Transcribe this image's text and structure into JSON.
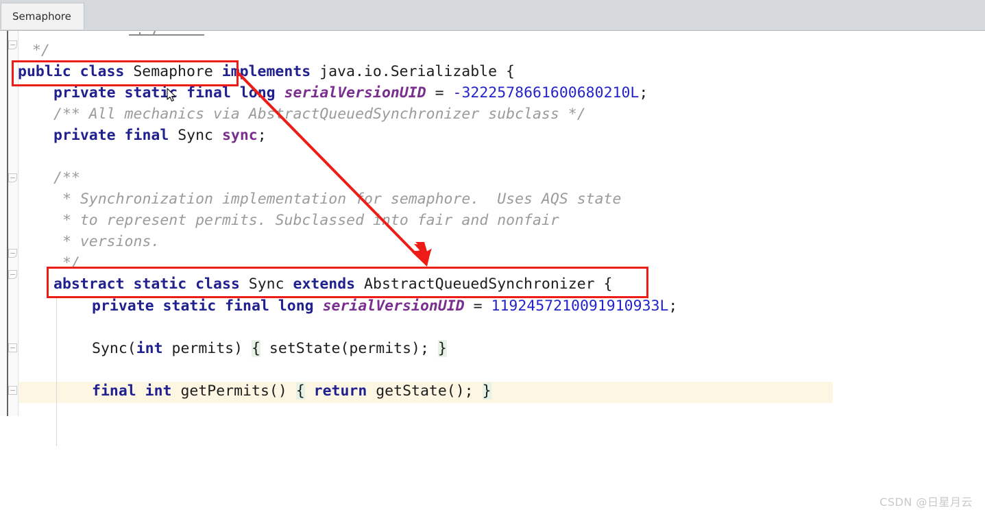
{
  "window": {
    "tab_label": "Semaphore"
  },
  "editor": {
    "language": "java",
    "lines": [
      {
        "n": 1,
        "indent": 0,
        "text": " */"
      },
      {
        "n": 2,
        "indent": 0,
        "text": "public class Semaphore implements java.io.Serializable {"
      },
      {
        "n": 3,
        "indent": 1,
        "text": "private static final long serialVersionUID = -3222578661600680210L;"
      },
      {
        "n": 4,
        "indent": 1,
        "text": "/** All mechanics via AbstractQueuedSynchronizer subclass */"
      },
      {
        "n": 5,
        "indent": 1,
        "text": "private final Sync sync;"
      },
      {
        "n": 6,
        "indent": 0,
        "text": ""
      },
      {
        "n": 7,
        "indent": 1,
        "text": "/**"
      },
      {
        "n": 8,
        "indent": 1,
        "text": " * Synchronization implementation for semaphore.  Uses AQS state"
      },
      {
        "n": 9,
        "indent": 1,
        "text": " * to represent permits. Subclassed into fair and nonfair"
      },
      {
        "n": 10,
        "indent": 1,
        "text": " * versions."
      },
      {
        "n": 11,
        "indent": 1,
        "text": " */"
      },
      {
        "n": 12,
        "indent": 1,
        "text": "abstract static class Sync extends AbstractQueuedSynchronizer {"
      },
      {
        "n": 13,
        "indent": 2,
        "text": "private static final long serialVersionUID = 1192457210091910933L;"
      },
      {
        "n": 14,
        "indent": 0,
        "text": ""
      },
      {
        "n": 15,
        "indent": 2,
        "text": "Sync(int permits) { setState(permits); }"
      },
      {
        "n": 16,
        "indent": 0,
        "text": ""
      },
      {
        "n": 17,
        "indent": 2,
        "text": "final int getPermits() { return getState(); }"
      }
    ],
    "tokens": {
      "line2": [
        {
          "t": "public",
          "c": "kw"
        },
        {
          "t": " ",
          "c": "plain"
        },
        {
          "t": "class",
          "c": "kw"
        },
        {
          "t": " ",
          "c": "plain"
        },
        {
          "t": "Semaphore",
          "c": "ident"
        },
        {
          "t": " ",
          "c": "plain"
        },
        {
          "t": "implements",
          "c": "kw"
        },
        {
          "t": " java.io.Serializable {",
          "c": "plain"
        }
      ],
      "line3": [
        {
          "t": "private static final long",
          "c": "kw"
        },
        {
          "t": " ",
          "c": "plain"
        },
        {
          "t": "serialVersionUID",
          "c": "field"
        },
        {
          "t": " = ",
          "c": "plain"
        },
        {
          "t": "-3222578661600680210L",
          "c": "num"
        },
        {
          "t": ";",
          "c": "plain"
        }
      ],
      "line5": [
        {
          "t": "private final",
          "c": "kw"
        },
        {
          "t": " Sync ",
          "c": "plain"
        },
        {
          "t": "sync",
          "c": "fieldu"
        },
        {
          "t": ";",
          "c": "plain"
        }
      ],
      "line12": [
        {
          "t": "abstract static class",
          "c": "kw"
        },
        {
          "t": " Sync ",
          "c": "plain"
        },
        {
          "t": "extends",
          "c": "kw"
        },
        {
          "t": " AbstractQueuedSynchronizer {",
          "c": "plain"
        }
      ],
      "line13": [
        {
          "t": "private static final long",
          "c": "kw"
        },
        {
          "t": " ",
          "c": "plain"
        },
        {
          "t": "serialVersionUID",
          "c": "field"
        },
        {
          "t": " = ",
          "c": "plain"
        },
        {
          "t": "1192457210091910933L",
          "c": "num"
        },
        {
          "t": ";",
          "c": "plain"
        }
      ],
      "line15": [
        {
          "t": "Sync(",
          "c": "plain"
        },
        {
          "t": "int",
          "c": "kw"
        },
        {
          "t": " permits) ",
          "c": "plain"
        },
        {
          "t": "{",
          "c": "brace"
        },
        {
          "t": " setState(permits); ",
          "c": "plain"
        },
        {
          "t": "}",
          "c": "brace"
        }
      ],
      "line17": [
        {
          "t": "final int",
          "c": "kw"
        },
        {
          "t": " getPermits() ",
          "c": "plain"
        },
        {
          "t": "{",
          "c": "brace"
        },
        {
          "t": " ",
          "c": "plain"
        },
        {
          "t": "return",
          "c": "kw"
        },
        {
          "t": " getState(); ",
          "c": "plain"
        },
        {
          "t": "}",
          "c": "brace"
        }
      ]
    },
    "line_texts": {
      "l1": " */",
      "l4": "/** All mechanics via AbstractQueuedSynchronizer subclass */",
      "l7": "/**",
      "l8": " * Synchronization implementation for semaphore.  Uses AQS state",
      "l9": " * to represent permits. Subclassed into fair and nonfair",
      "l10": " * versions.",
      "l11": " */"
    }
  },
  "annotations": {
    "color": "#ee1c16",
    "box1_target": "public class Semaphore",
    "box2_target": "abstract static class Sync extends AbstractQueuedSynchronizer",
    "arrow_from": "public class Semaphore",
    "arrow_to": "abstract static class Sync extends AbstractQueuedSynchronizer"
  },
  "colors": {
    "keyword": "#20208f",
    "field": "#7a2f8f",
    "number": "#2323c8",
    "comment": "#9b9b9b",
    "annotation_red": "#ee1c16",
    "current_line": "#fcf6e3",
    "brace_match": "#e6f2e6",
    "tab_bar": "#d6d9dc"
  },
  "watermark": {
    "text": "CSDN @日星月云"
  }
}
